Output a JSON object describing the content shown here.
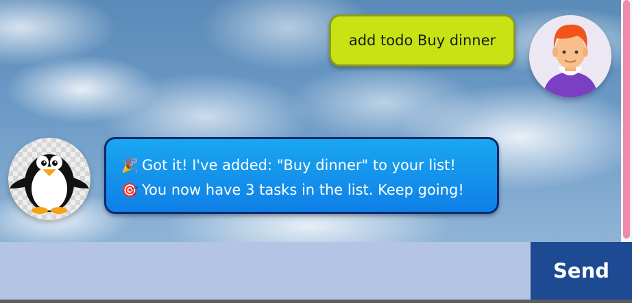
{
  "colors": {
    "user_bubble": "#c8e314",
    "bot_bubble": "#1a8ff0",
    "input_background": "#b4c4e4",
    "send_button": "#1e4a93",
    "scrollbar_thumb": "#f08aa8"
  },
  "messages": [
    {
      "sender": "user",
      "avatar": "user-avatar",
      "text": "add todo Buy dinner"
    },
    {
      "sender": "bot",
      "avatar": "penguin-avatar",
      "lines": [
        {
          "icon": "party-popper-icon",
          "glyph": "🎉",
          "text": "Got it! I've added: \"Buy dinner\" to your list!"
        },
        {
          "icon": "target-icon",
          "glyph": "🎯",
          "text": "You now have 3 tasks in the list. Keep going!"
        }
      ]
    }
  ],
  "composer": {
    "value": "",
    "placeholder": "",
    "send_label": "Send"
  }
}
